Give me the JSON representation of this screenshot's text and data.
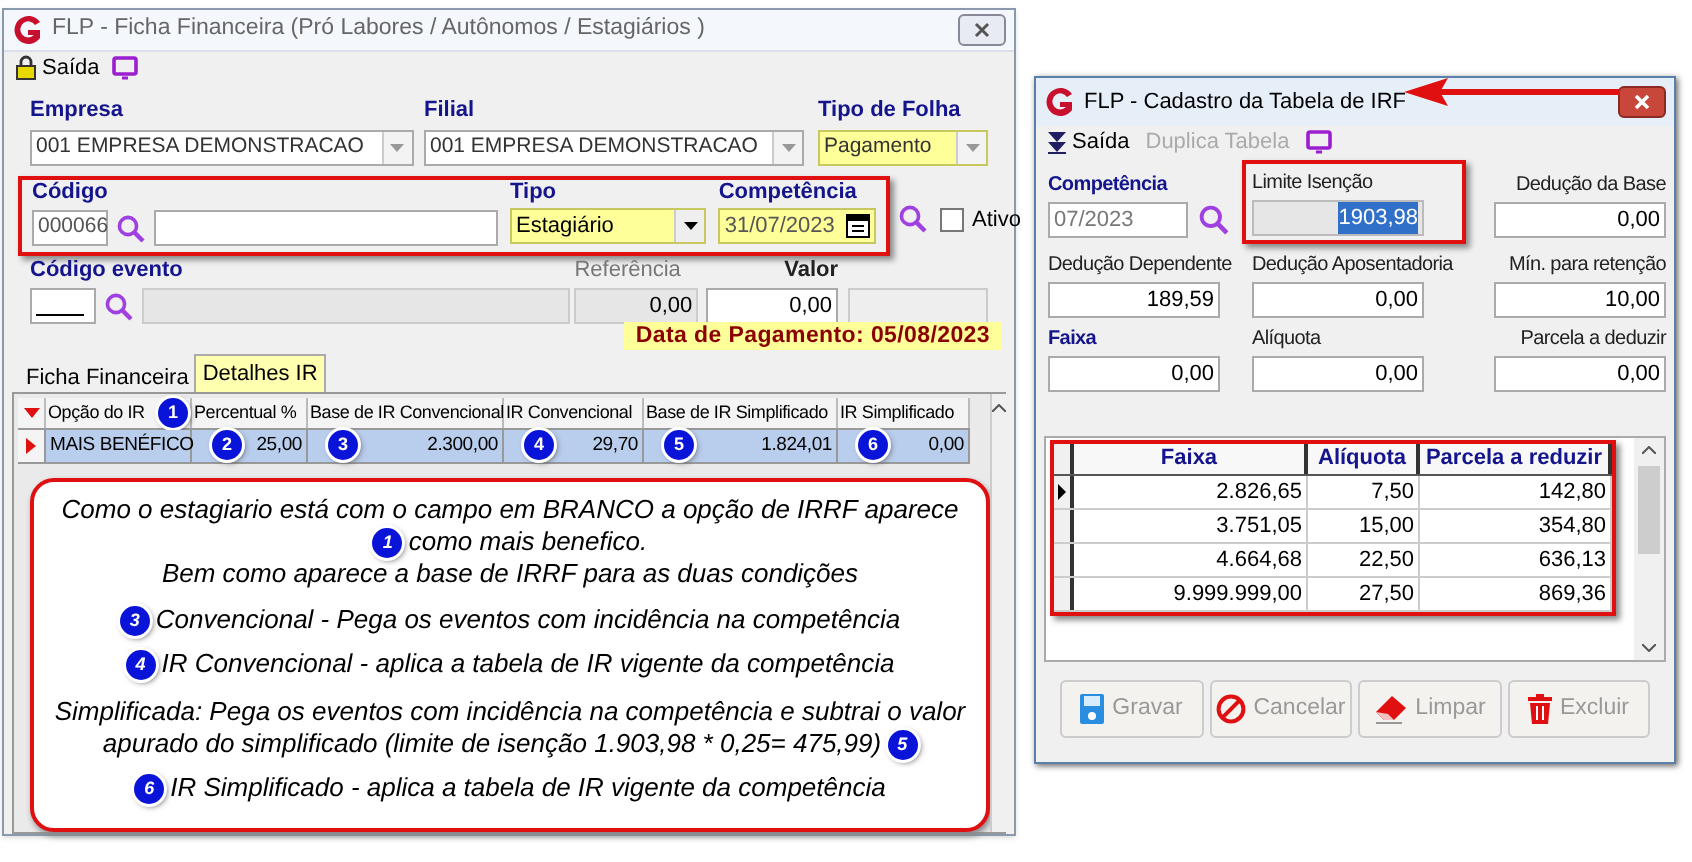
{
  "payroll_window": {
    "title": "FLP - Ficha Financeira (Pró Labores / Autônomos / Estagiários )",
    "toolbar": [
      {
        "label": "Saída"
      }
    ],
    "empresa": {
      "label": "Empresa",
      "value": "001 EMPRESA DEMONSTRACAO",
      "highlighted": false
    },
    "filial": {
      "label": "Filial",
      "value": "001 EMPRESA DEMONSTRACAO",
      "highlighted": false
    },
    "tipo_folha": {
      "label": "Tipo de Folha",
      "value": "Pagamento",
      "highlighted": true
    },
    "codigo": {
      "label": "Código",
      "value": "000066"
    },
    "tipo": {
      "label": "Tipo",
      "value": "Estagiário",
      "highlighted": true
    },
    "competencia": {
      "label": "Competência",
      "value": "31/07/2023",
      "highlighted": true
    },
    "ativo": {
      "label": "Ativo",
      "checked": false
    },
    "codigo_evento": {
      "label": "Código evento"
    },
    "referencia": {
      "label": "Referência",
      "value": "0,00",
      "disabled": true
    },
    "valor": {
      "label": "Valor",
      "value": "0,00",
      "disabled": false
    },
    "payment_date": "Data de Pagamento: 05/08/2023",
    "tabs": [
      {
        "label": "Ficha Financeira",
        "selected": false
      },
      {
        "label": "Detalhes IR",
        "selected": true
      }
    ],
    "grid": {
      "columns": [
        {
          "label": "Opção do IR",
          "badge": "1"
        },
        {
          "label": "Percentual %"
        },
        {
          "label": "Base de IR Convencional"
        },
        {
          "label": "IR Convencional"
        },
        {
          "label": "Base de IR Simplificado"
        },
        {
          "label": "IR Simplificado"
        }
      ],
      "rows": [
        {
          "selected": true,
          "cells": [
            {
              "text": "MAIS BENÉFICO"
            },
            {
              "text": "25,00",
              "badge": "2"
            },
            {
              "text": "2.300,00",
              "badge": "3"
            },
            {
              "text": "29,70",
              "badge": "4"
            },
            {
              "text": "1.824,01",
              "badge": "5"
            },
            {
              "text": "0,00",
              "badge": "6"
            }
          ]
        }
      ]
    },
    "note": [
      {
        "text": "Como o estagiario está com o campo em BRANCO a opção de IRRF aparece"
      },
      {
        "badge": "1",
        "text": "como mais benefico."
      },
      {
        "text": "Bem como aparece a base de IRRF para as duas condições"
      },
      {
        "badge": "3",
        "text": "Convencional - Pega os eventos com incidência na competência"
      },
      {
        "badge": "4",
        "text": "IR Convencional - aplica a tabela de IR vigente da competência"
      },
      {
        "text": "Simplificada: Pega os eventos com incidência na competência e subtrai o valor"
      },
      {
        "text": "apurado do simplificado (limite de isenção 1.903,98 * 0,25= 475,99)",
        "badge_after": "5"
      },
      {
        "badge": "6",
        "text": "IR Simplificado - aplica a tabela de IR vigente da competência"
      }
    ]
  },
  "irf_window": {
    "title": "FLP - Cadastro da Tabela de IRF",
    "toolbar": [
      {
        "label": "Saída",
        "disabled": false
      },
      {
        "label": "Duplica Tabela",
        "disabled": true
      }
    ],
    "fields": [
      {
        "label": "Competência",
        "value": "07/2023",
        "kind": "lookup",
        "text_selected": false
      },
      {
        "label": "Limite Isenção",
        "value": "1903,98",
        "kind": "readonly",
        "text_selected": true
      },
      {
        "label": "Dedução da Base",
        "value": "0,00",
        "kind": "number",
        "text_selected": false
      },
      {
        "label": "Dedução Dependente",
        "value": "189,59",
        "kind": "number",
        "text_selected": false
      },
      {
        "label": "Dedução Aposentadoria",
        "value": "0,00",
        "kind": "number",
        "text_selected": false
      },
      {
        "label": "Mín. para retenção",
        "value": "10,00",
        "kind": "number",
        "text_selected": false
      },
      {
        "label": "Faixa",
        "value": "0,00",
        "kind": "key",
        "text_selected": false
      },
      {
        "label": "Alíquota",
        "value": "0,00",
        "kind": "number",
        "text_selected": false
      },
      {
        "label": "Parcela a deduzir",
        "value": "0,00",
        "kind": "number",
        "text_selected": false
      }
    ],
    "table": {
      "columns": [
        "Faixa",
        "Alíquota",
        "Parcela a reduzir"
      ],
      "rows": [
        {
          "current": true,
          "cells": [
            "2.826,65",
            "7,50",
            "142,80"
          ]
        },
        {
          "current": false,
          "cells": [
            "3.751,05",
            "15,00",
            "354,80"
          ]
        },
        {
          "current": false,
          "cells": [
            "4.664,68",
            "22,50",
            "636,13"
          ]
        },
        {
          "current": false,
          "cells": [
            "9.999.999,00",
            "27,50",
            "869,36"
          ]
        }
      ]
    },
    "buttons": [
      {
        "label": "Gravar",
        "disabled": true
      },
      {
        "label": "Cancelar",
        "disabled": true
      },
      {
        "label": "Limpar",
        "disabled": true
      },
      {
        "label": "Excluir",
        "disabled": true
      }
    ]
  }
}
